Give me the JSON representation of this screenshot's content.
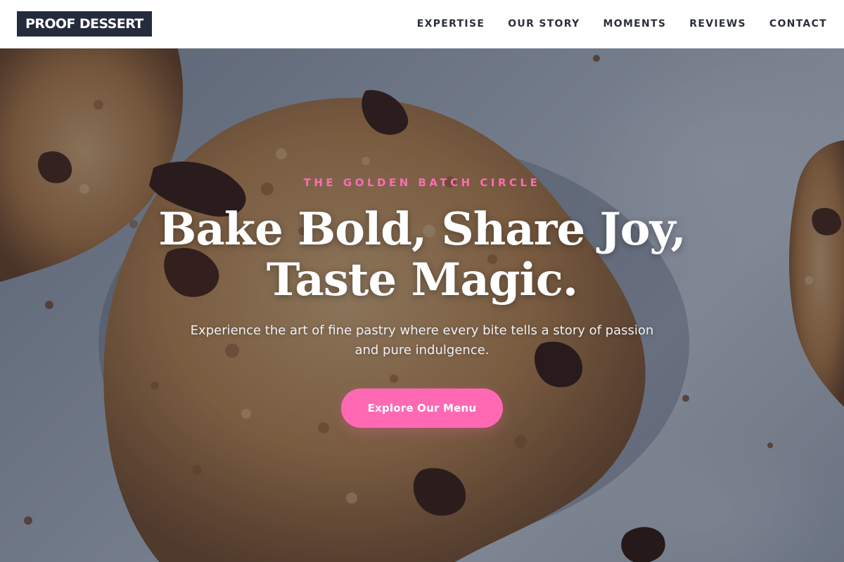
{
  "brand": {
    "name": "PROOF DESSERT",
    "logo_bg": "#232b3d"
  },
  "nav": {
    "items": [
      {
        "label": "EXPERTISE"
      },
      {
        "label": "OUR STORY"
      },
      {
        "label": "MOMENTS"
      },
      {
        "label": "REVIEWS"
      },
      {
        "label": "CONTACT"
      }
    ]
  },
  "hero": {
    "eyebrow": "THE GOLDEN BATCH CIRCLE",
    "headline_line1": "Bake Bold, Share Joy,",
    "headline_line2": "Taste Magic.",
    "subtext": "Experience the art of fine pastry where every bite tells a story of passion and pure indulgence.",
    "cta_label": "Explore Our Menu",
    "background_subject": "chocolate-chip-cookies-photo"
  },
  "colors": {
    "accent": "#ff69b4",
    "eyebrow": "#ff6bb5",
    "nav_text": "#2a2f3a",
    "headline": "#ffffff"
  }
}
